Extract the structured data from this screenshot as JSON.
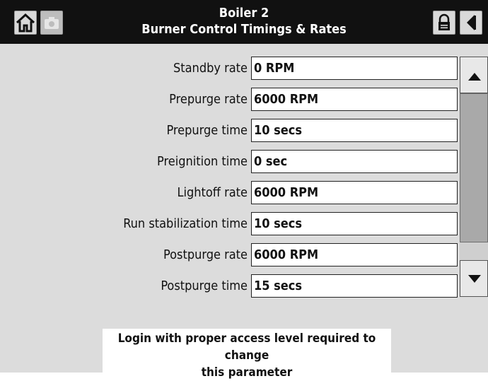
{
  "header": {
    "title": "Boiler 2",
    "subtitle": "Burner Control Timings & Rates",
    "icons": {
      "home": "home-icon",
      "camera": "camera-icon",
      "lock": "lock-icon",
      "back": "back-arrow-icon"
    }
  },
  "parameters": [
    {
      "label": "Standby rate",
      "value": "0 RPM"
    },
    {
      "label": "Prepurge rate",
      "value": "6000 RPM"
    },
    {
      "label": "Prepurge time",
      "value": "10 secs"
    },
    {
      "label": "Preignition time",
      "value": "0 sec"
    },
    {
      "label": "Lightoff rate",
      "value": "6000 RPM"
    },
    {
      "label": "Run stabilization time",
      "value": "10 secs"
    },
    {
      "label": "Postpurge rate",
      "value": "6000 RPM"
    },
    {
      "label": "Postpurge time",
      "value": "15 secs"
    }
  ],
  "scrollbar": {
    "up_icon": "triangle-up-icon",
    "down_icon": "triangle-down-icon"
  },
  "notice": {
    "line1": "Login with proper access level required to change",
    "line2": "this parameter"
  },
  "colors": {
    "header_bg": "#111111",
    "content_bg": "#dcdcdc",
    "field_bg": "#ffffff"
  }
}
